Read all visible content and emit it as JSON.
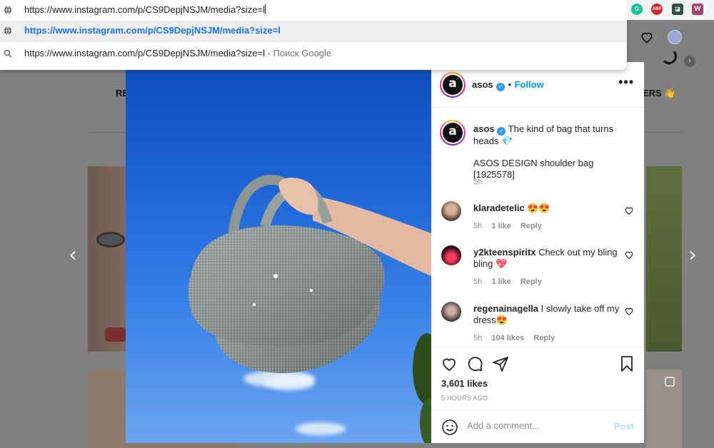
{
  "browser": {
    "address_value": "https://www.instagram.com/p/CS9DepjNSJM/media?size=l",
    "suggestions": [
      {
        "icon": "globe-icon",
        "text": "https://www.instagram.com/p/CS9DepjNSJM/media?size=l",
        "suffix": ""
      },
      {
        "icon": "search-icon",
        "text": "https://www.instagram.com/p/CS9DepjNSJM/media?size=l",
        "suffix": " - Поиск Google"
      }
    ],
    "extensions": [
      "grammarly-icon",
      "adblock-plus-icon",
      "extension-icon",
      "w-extension-icon"
    ],
    "extension_labels": {
      "abp": "ABP",
      "w": "W"
    }
  },
  "background_page": {
    "story_left_label": "RE",
    "story_right_label": "ERS 👋"
  },
  "post": {
    "username": "asos",
    "avatar_letter": "a",
    "follow_label": "Follow",
    "more_label": "•••",
    "caption": {
      "text": "The kind of bag that turns heads 💎",
      "detail": "ASOS DESIGN shoulder bag [1925578]",
      "time": "5h"
    },
    "comments": [
      {
        "username": "klaradetelic",
        "text": "😍😍",
        "time": "5h",
        "likes": "1 like",
        "reply": "Reply"
      },
      {
        "username": "y2kteenspiritx",
        "text": "Check out my bling bling 💖",
        "time": "5h",
        "likes": "1 like",
        "reply": "Reply"
      },
      {
        "username": "regenainagella",
        "text": "I slowly take off my dress😍",
        "time": "5h",
        "likes": "104 likes",
        "reply": "Reply"
      }
    ],
    "likes": "3,601 likes",
    "time_ago": "5 HOURS AGO",
    "comment_placeholder": "Add a comment...",
    "post_button": "Post",
    "colors": {
      "follow": "#0095f6",
      "verified": "#3897f0",
      "post_disabled": "#b2dffc"
    }
  }
}
